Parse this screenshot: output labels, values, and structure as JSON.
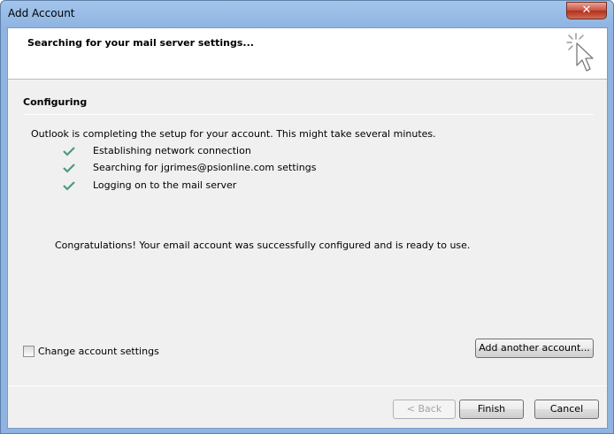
{
  "window": {
    "title": "Add Account",
    "close_glyph": "✕"
  },
  "header": {
    "title": "Searching for your mail server settings...",
    "icon": "cursor-click-icon"
  },
  "section": {
    "title": "Configuring",
    "intro": "Outlook is completing the setup for your account. This might take several minutes.",
    "steps": [
      {
        "label": "Establishing network connection",
        "status": "done"
      },
      {
        "label": "Searching for jgrimes@psionline.com settings",
        "status": "done"
      },
      {
        "label": "Logging on to the mail server",
        "status": "done"
      }
    ],
    "congrats": "Congratulations! Your email account was successfully configured and is ready to use."
  },
  "options": {
    "change_settings_label": "Change account settings",
    "change_settings_checked": false,
    "add_another_label": "Add another account..."
  },
  "footer": {
    "back_label": "< Back",
    "back_enabled": false,
    "finish_label": "Finish",
    "cancel_label": "Cancel"
  },
  "colors": {
    "check": "#4c9a7c",
    "title_bar": "#8fb4e2"
  }
}
